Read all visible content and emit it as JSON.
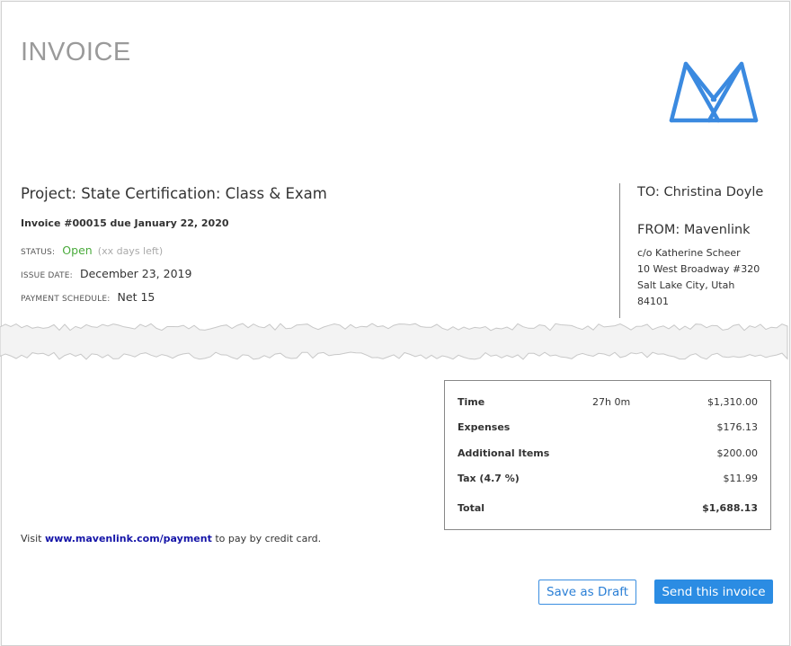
{
  "header": {
    "title": "INVOICE",
    "logo_icon": "mavenlink-logo-icon",
    "logo_color": "#3b8ae0"
  },
  "project": {
    "title": "Project: State Certification: Class & Exam",
    "invoice_line": "Invoice #00015 due January 22, 2020",
    "status_label": "STATUS:",
    "status_value": "Open",
    "status_note": "(xx days left)",
    "status_color": "#4aab3c",
    "issue_label": "ISSUE DATE:",
    "issue_value": "December 23, 2019",
    "schedule_label": "PAYMENT SCHEDULE:",
    "schedule_value": "Net 15"
  },
  "recipient": {
    "to": "TO: Christina Doyle",
    "from": "FROM: Mavenlink",
    "address": [
      "c/o Katherine Scheer",
      "10 West Broadway #320",
      "Salt Lake City, Utah",
      "84101"
    ]
  },
  "totals": {
    "rows": [
      {
        "label": "Time",
        "hours": "27h 0m",
        "amount": "$1,310.00"
      },
      {
        "label": "Expenses",
        "hours": "",
        "amount": "$176.13"
      },
      {
        "label": "Additional Items",
        "hours": "",
        "amount": "$200.00"
      },
      {
        "label": "Tax (4.7 %)",
        "hours": "",
        "amount": "$11.99"
      }
    ],
    "total_label": "Total",
    "total_amount": "$1,688.13"
  },
  "payment": {
    "prefix": "Visit",
    "link": "www.mavenlink.com/payment",
    "suffix": "to pay by credit card."
  },
  "actions": {
    "save_draft": "Save as Draft",
    "send": "Send this invoice",
    "accent_color": "#2b8ce3"
  }
}
